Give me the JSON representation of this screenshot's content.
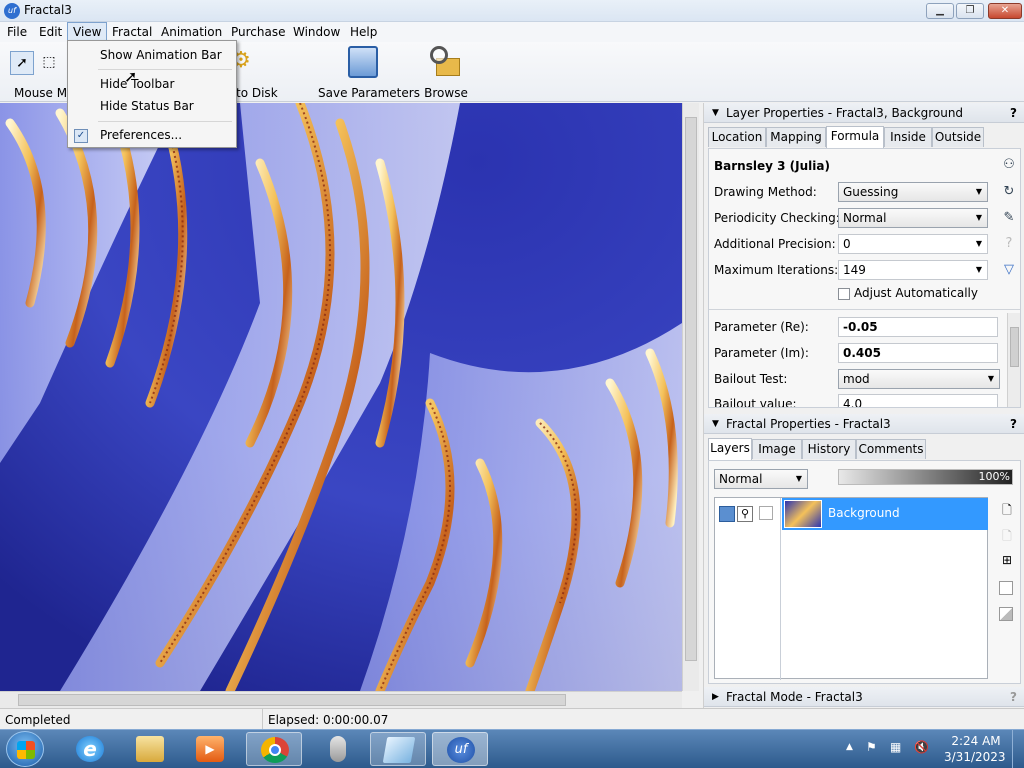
{
  "window": {
    "title": "Fractal3",
    "app_icon_text": "uf",
    "min_label": "▁",
    "max_label": "❐",
    "close_label": "✕"
  },
  "menubar": {
    "items": [
      "File",
      "Edit",
      "View",
      "Fractal",
      "Animation",
      "Purchase",
      "Window",
      "Help"
    ],
    "active": "View"
  },
  "view_menu": {
    "items": [
      "Show Animation Bar",
      "Hide Toolbar",
      "Hide Status Bar",
      "Preferences..."
    ],
    "checked": "Preferences..."
  },
  "toolbar": {
    "mouse_mode_label": "Mouse Mo",
    "save_disk_label": "to Disk",
    "save_parameters_label": "Save Parameters",
    "browse_label": "Browse"
  },
  "layer_properties": {
    "title": "Layer Properties - Fractal3, Background",
    "help": "?",
    "tabs": [
      "Location",
      "Mapping",
      "Formula",
      "Inside",
      "Outside"
    ],
    "selected_tab": "Formula",
    "formula_name": "Barnsley 3 (Julia)",
    "fields": {
      "drawing_method": {
        "label": "Drawing Method:",
        "value": "Guessing"
      },
      "periodicity": {
        "label": "Periodicity Checking:",
        "value": "Normal"
      },
      "precision": {
        "label": "Additional Precision:",
        "value": "0"
      },
      "iterations": {
        "label": "Maximum Iterations:",
        "value": "149"
      },
      "adjust_auto": {
        "label": "Adjust Automatically",
        "checked": false
      },
      "param_re": {
        "label": "Parameter (Re):",
        "value": "-0.05"
      },
      "param_im": {
        "label": "Parameter (Im):",
        "value": "0.405"
      },
      "bailout_test": {
        "label": "Bailout Test:",
        "value": "mod"
      },
      "bailout_value": {
        "label": "Bailout value:",
        "value": "4.0"
      }
    }
  },
  "fractal_properties": {
    "title": "Fractal Properties - Fractal3",
    "help": "?",
    "tabs": [
      "Layers",
      "Image",
      "History",
      "Comments"
    ],
    "selected_tab": "Layers",
    "blend_mode": "Normal",
    "opacity": "100%",
    "layers": [
      {
        "name": "Background",
        "selected": true
      }
    ]
  },
  "fractal_mode": {
    "title": "Fractal Mode - Fractal3",
    "help": "?"
  },
  "statusbar": {
    "status": "Completed",
    "elapsed": "Elapsed: 0:00:00.07"
  },
  "taskbar": {
    "time": "2:24 AM",
    "date": "3/31/2023"
  },
  "colors": {
    "accent": "#3399ff",
    "fractal_blue": "#2a2fa8",
    "fractal_gold": "#e8a23a"
  }
}
